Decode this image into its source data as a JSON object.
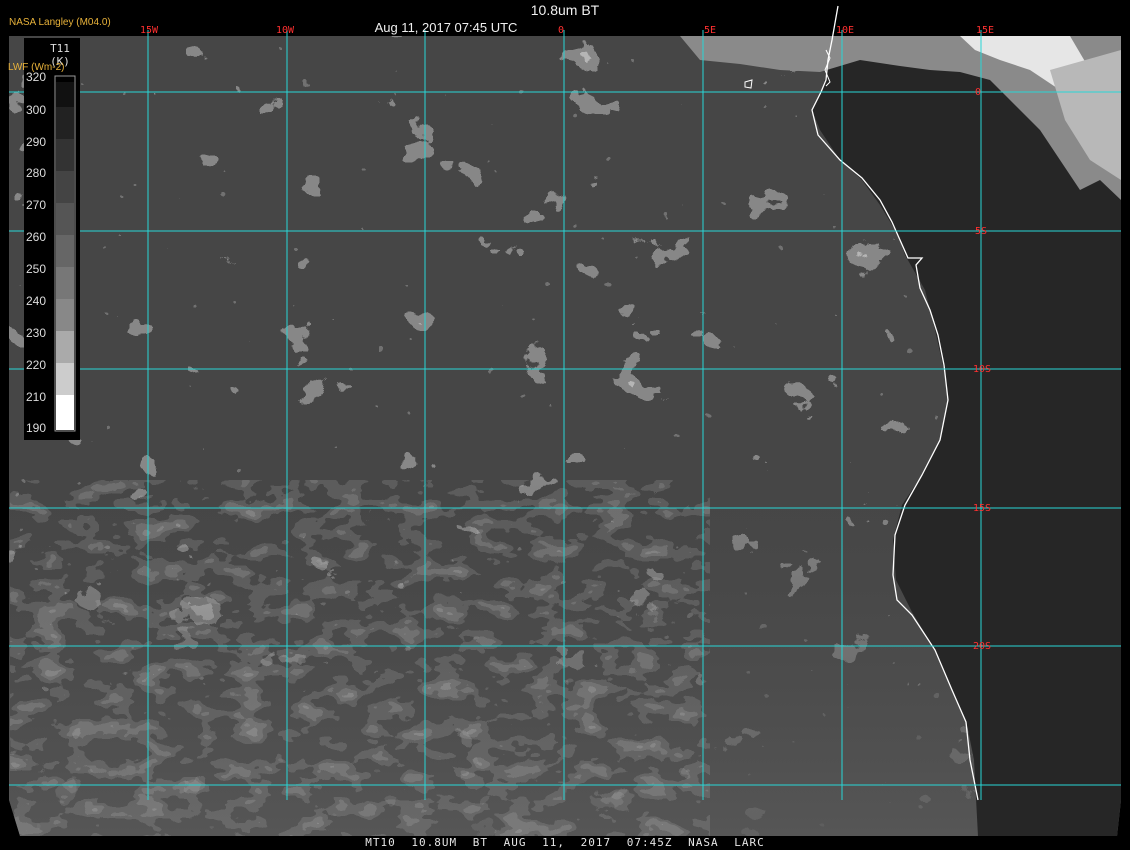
{
  "header": {
    "title": "10.8um BT",
    "subtitle": "Aug 11, 2017 07:45 UTC",
    "org": "NASA Langley (M04.0)"
  },
  "colorbar": {
    "variable": "T11",
    "unit": "(K)",
    "overlay_label": "LWF (Wm-2)",
    "ticks": [
      "320",
      "300",
      "290",
      "280",
      "270",
      "260",
      "250",
      "240",
      "230",
      "220",
      "210",
      "190"
    ]
  },
  "grid": {
    "longitude_labels": [
      "15W",
      "10W",
      "0",
      "5E",
      "10E",
      "15E"
    ],
    "latitude_labels": [
      "0",
      "5S",
      "10S",
      "15S",
      "20S"
    ],
    "line_color": "#28d6d6",
    "label_color": "#ff3030",
    "coastline_color": "#ffffff"
  },
  "footer": {
    "text": "MT10 10.8UM BT AUG 11, 2017 07:45Z NASA LARC"
  }
}
